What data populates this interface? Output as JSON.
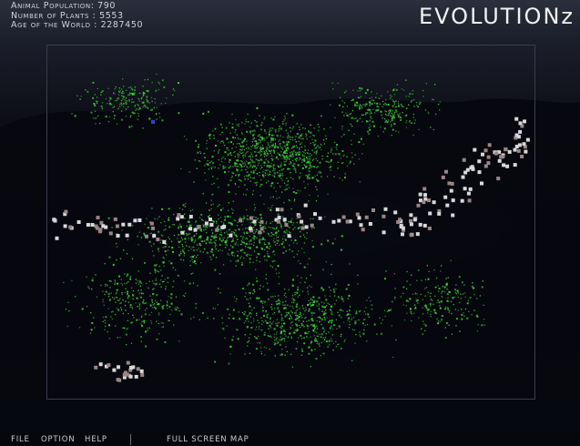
{
  "app": {
    "title": "EVOLUTIONz"
  },
  "stats": {
    "animal_population": "Animal Population: 790",
    "plant_count": "Number of Plants : 5553",
    "world_age": "Age of the World : 2287450"
  },
  "menu": {
    "file": "FILE",
    "option": "OPTION",
    "help": "HELP",
    "full_screen_map": "FULL SCREEN MAP"
  },
  "colors": {
    "plant": "#3fcf3a",
    "animal_light": "#d8d8d8",
    "animal_dim": "#9a8484",
    "animal_blue": "#3040e0"
  }
}
